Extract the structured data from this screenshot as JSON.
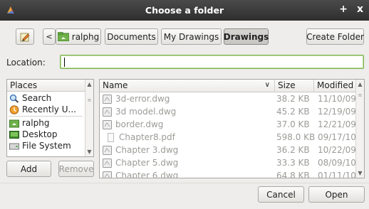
{
  "window": {
    "title": "Choose a folder",
    "plus_label": "+",
    "close_label": "x"
  },
  "breadcrumbs": [
    {
      "label": "ralphg"
    },
    {
      "label": "Documents"
    },
    {
      "label": "My Drawings"
    },
    {
      "label": "Drawings"
    }
  ],
  "toolbar": {
    "create_folder_label": "Create Folder"
  },
  "location": {
    "label": "Location:",
    "value": ""
  },
  "places": {
    "header": "Places",
    "items": [
      {
        "label": "Search",
        "icon": "search-icon"
      },
      {
        "label": "Recently U...",
        "icon": "recent-icon"
      },
      {
        "label": "ralphg",
        "icon": "home-folder-icon"
      },
      {
        "label": "Desktop",
        "icon": "desktop-icon"
      },
      {
        "label": "File System",
        "icon": "drive-icon"
      }
    ],
    "add_label": "Add",
    "remove_label": "Remove"
  },
  "files": {
    "columns": {
      "name": "Name",
      "size": "Size",
      "modified": "Modified"
    },
    "rows": [
      {
        "name": "3d-error.dwg",
        "size": "38.2 KB",
        "modified": "11/10/09",
        "icon": "dwg-file-icon"
      },
      {
        "name": "3d model.dwg",
        "size": "45.2 KB",
        "modified": "12/19/09",
        "icon": "dwg-file-icon"
      },
      {
        "name": "border.dwg",
        "size": "37.0 KB",
        "modified": "12/21/09",
        "icon": "dwg-file-icon"
      },
      {
        "name": "Chapter8.pdf",
        "size": "598.0 KB",
        "modified": "09/17/10",
        "icon": "pdf-file-icon"
      },
      {
        "name": "Chapter 3.dwg",
        "size": "36.2 KB",
        "modified": "10/22/09",
        "icon": "dwg-file-icon"
      },
      {
        "name": "Chapter 5.dwg",
        "size": "33.3 KB",
        "modified": "08/09/10",
        "icon": "dwg-file-icon"
      },
      {
        "name": "Chapter 6.dwg",
        "size": "64.8 KB",
        "modified": "01/11/10",
        "icon": "dwg-file-icon"
      }
    ]
  },
  "actions": {
    "cancel_label": "Cancel",
    "open_label": "Open"
  },
  "colors": {
    "accent_border": "#7fb34f",
    "titlebar": "#3a3a3a",
    "disabled_text": "#9b9b97"
  }
}
